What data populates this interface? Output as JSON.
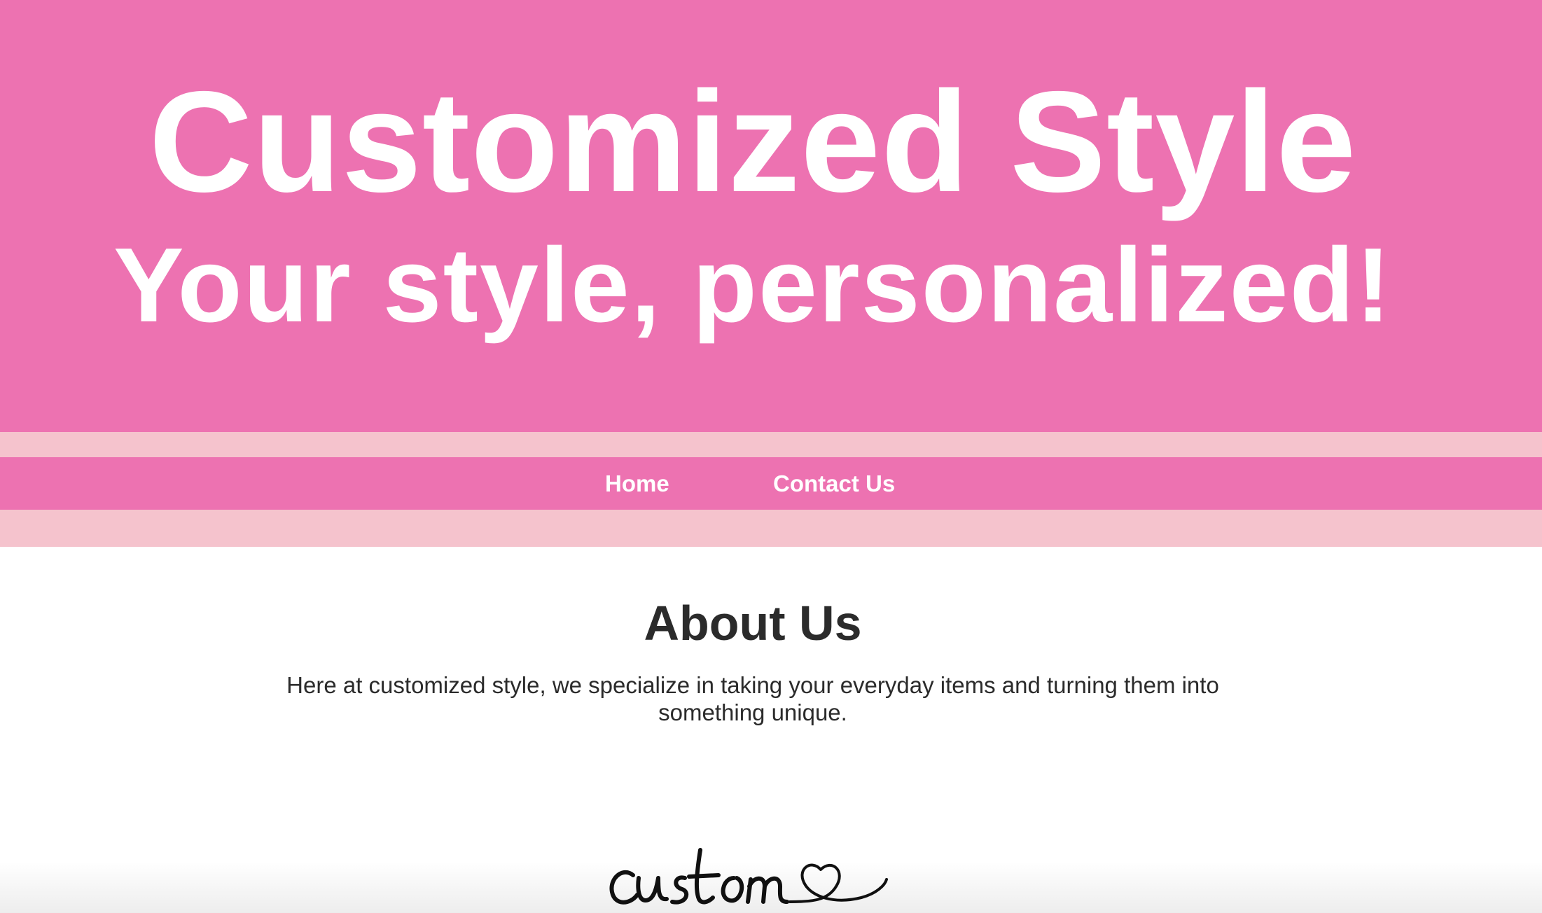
{
  "header": {
    "title": "Customized Style",
    "tagline": "Your style, personalized!"
  },
  "nav": {
    "items": [
      {
        "label": "Home"
      },
      {
        "label": "Contact Us"
      }
    ]
  },
  "about": {
    "heading": "About Us",
    "text": "Here at customized style, we specialize in taking your everyday items and turning them into something unique."
  },
  "logo": {
    "text": "custom",
    "icon": "heart-icon"
  },
  "colors": {
    "brand_pink": "#ed72b1",
    "light_pink": "#f5c3cd",
    "text_dark": "#2b2b2b",
    "white": "#ffffff"
  }
}
